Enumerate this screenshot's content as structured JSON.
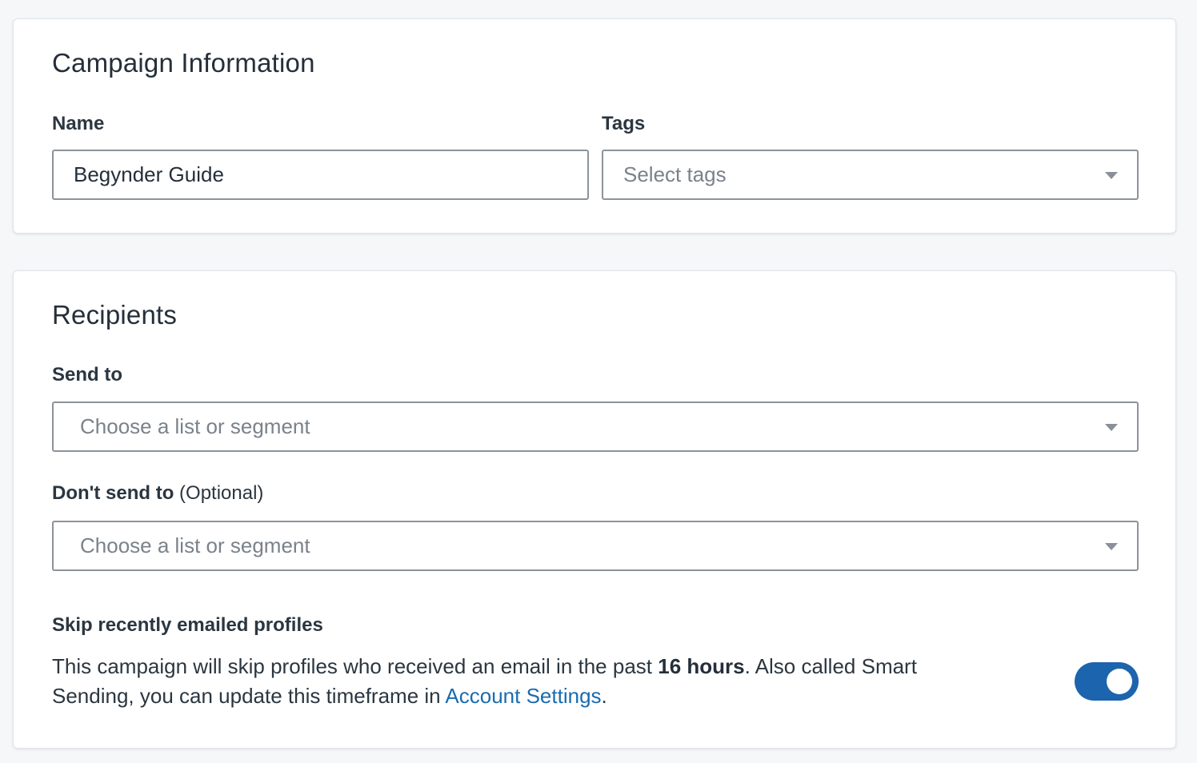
{
  "campaign_info": {
    "title": "Campaign Information",
    "name_label": "Name",
    "name_value": "Begynder Guide",
    "tags_label": "Tags",
    "tags_placeholder": "Select tags"
  },
  "recipients": {
    "title": "Recipients",
    "send_to_label": "Send to",
    "send_to_placeholder": "Choose a list or segment",
    "dont_send_label": "Don't send to",
    "dont_send_optional": "(Optional)",
    "dont_send_placeholder": "Choose a list or segment",
    "skip_label": "Skip recently emailed profiles",
    "skip_desc_1": "This campaign will skip profiles who received an email in the past ",
    "skip_hours": "16 hours",
    "skip_desc_2": ". Also called Smart Sending, you can update this timeframe in ",
    "skip_link": "Account Settings",
    "skip_desc_3": ".",
    "skip_enabled": true
  },
  "colors": {
    "accent": "#1c64ad",
    "link": "#1a6bb0",
    "background": "#f6f7f8"
  },
  "icons": {
    "dropdown": "chevron-down-icon"
  }
}
